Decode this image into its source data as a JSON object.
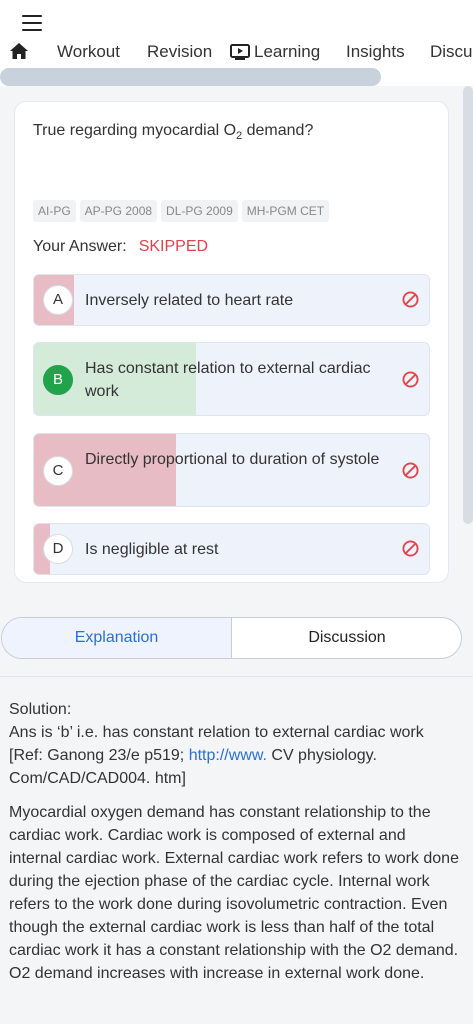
{
  "nav": {
    "tabs": [
      "Workout",
      "Revision",
      "Learning",
      "Insights",
      "Discu"
    ]
  },
  "question": {
    "text_before": "True regarding myocardial O",
    "text_sub": "2",
    "text_after": " demand?",
    "tags": [
      "AI-PG",
      "AP-PG 2008",
      "DL-PG 2009",
      "MH-PGM CET"
    ],
    "your_answer_label": "Your Answer:",
    "your_answer_value": "SKIPPED",
    "options": [
      {
        "letter": "A",
        "text": "Inversely related to heart rate",
        "percent": 10,
        "fill_color": "#e8bcc4"
      },
      {
        "letter": "B",
        "text": "Has constant relation to external cardiac work",
        "percent": 41,
        "fill_color": "#d3ebd8"
      },
      {
        "letter": "C",
        "text": "Directly proportional to duration of systole",
        "percent": 36,
        "fill_color": "#e8bcc4"
      },
      {
        "letter": "D",
        "text": "Is negligible at rest",
        "percent": 4,
        "fill_color": "#e8bcc4"
      }
    ]
  },
  "segments": {
    "explanation": "Explanation",
    "discussion": "Discussion"
  },
  "solution": {
    "heading": "Solution:",
    "line1": "Ans is ‘b’ i.e. has constant relation to external cardiac work [Ref: Ganong 23/e p519; ",
    "link": "http://www.",
    "line1_end": " CV physiology. Com/CAD/CAD004. htm]",
    "paragraph": "Myocardial oxygen demand has constant relationship to the cardiac work. Cardiac work is composed of external and internal cardiac work. External cardiac work refers to work done during the ejection phase of the cardiac cycle. Internal work refers to the work done during isovolumetric contraction. Even though the external cardiac work is less than half of the total cardiac work it has a constant relationship with the O2 demand. O2 demand increases with increase in external work done."
  },
  "colors": {
    "accent": "#2a6fd1",
    "skipped": "#d9454f",
    "correct": "#22a24a",
    "wrong_icon": "#e0464f"
  }
}
